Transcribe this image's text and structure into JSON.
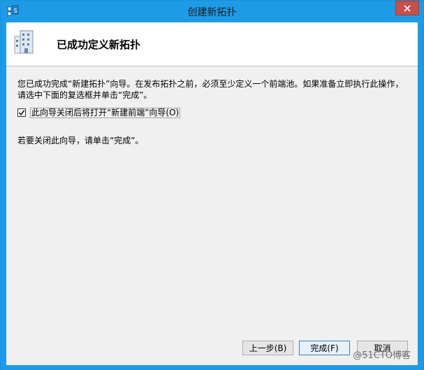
{
  "window": {
    "title": "创建新拓扑"
  },
  "header": {
    "title": "已成功定义新拓扑"
  },
  "content": {
    "description": "您已成功完成“新建拓扑”向导。在发布拓扑之前，必须至少定义一个前端池。如果准备立即执行此操作，请选中下面的复选框并单击“完成”。",
    "checkbox_label": "此向导关闭后将打开“新建前端”向导(O)",
    "checkbox_checked": true,
    "closing_text": "若要关闭此向导，请单击“完成”。"
  },
  "buttons": {
    "back": "上一步(B)",
    "finish": "完成(F)",
    "cancel": "取消"
  },
  "watermark": "@51CTO博客",
  "colors": {
    "title_bar": "#1e9be6",
    "close_button": "#c7504c",
    "client_bg": "#f0f0f0"
  },
  "icons": {
    "app": "topology-builder-icon",
    "header": "building-icon",
    "close": "close-icon",
    "check": "checkmark-icon"
  }
}
